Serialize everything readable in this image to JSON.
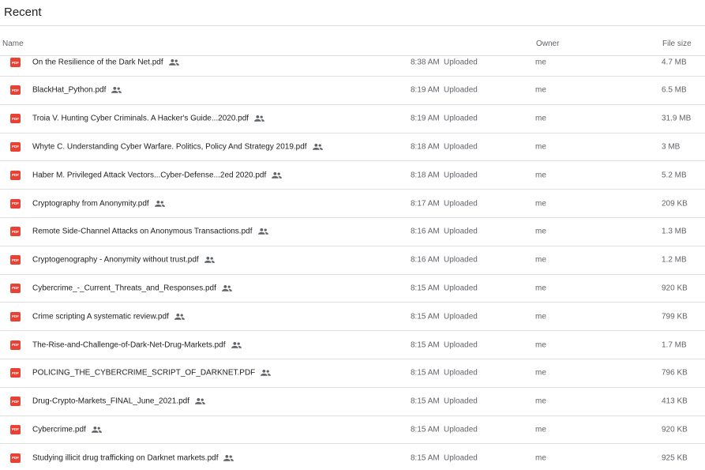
{
  "page": {
    "title": "Recent"
  },
  "columns": {
    "name": "Name",
    "owner": "Owner",
    "size": "File size"
  },
  "icons": {
    "file": "pdf-icon",
    "shared": "shared-people-icon",
    "pdf_color": "#e94235"
  },
  "files": [
    {
      "name": "On the Resilience of the Dark Net.pdf",
      "time": "8:38 AM",
      "action": "Uploaded",
      "owner": "me",
      "size": "4.7 MB"
    },
    {
      "name": "BlackHat_Python.pdf",
      "time": "8:19 AM",
      "action": "Uploaded",
      "owner": "me",
      "size": "6.5 MB"
    },
    {
      "name": "Troia V. Hunting Cyber Criminals. A Hacker's Guide...2020.pdf",
      "time": "8:19 AM",
      "action": "Uploaded",
      "owner": "me",
      "size": "31.9 MB"
    },
    {
      "name": "Whyte C. Understanding Cyber Warfare. Politics, Policy And Strategy 2019.pdf",
      "time": "8:18 AM",
      "action": "Uploaded",
      "owner": "me",
      "size": "3 MB"
    },
    {
      "name": "Haber M. Privileged Attack Vectors...Cyber-Defense...2ed 2020.pdf",
      "time": "8:18 AM",
      "action": "Uploaded",
      "owner": "me",
      "size": "5.2 MB"
    },
    {
      "name": "Cryptography from Anonymity.pdf",
      "time": "8:17 AM",
      "action": "Uploaded",
      "owner": "me",
      "size": "209 KB"
    },
    {
      "name": "Remote Side-Channel Attacks on Anonymous Transactions.pdf",
      "time": "8:16 AM",
      "action": "Uploaded",
      "owner": "me",
      "size": "1.3 MB"
    },
    {
      "name": "Cryptogenography - Anonymity without trust.pdf",
      "time": "8:16 AM",
      "action": "Uploaded",
      "owner": "me",
      "size": "1.2 MB"
    },
    {
      "name": "Cybercrime_-_Current_Threats_and_Responses.pdf",
      "time": "8:15 AM",
      "action": "Uploaded",
      "owner": "me",
      "size": "920 KB"
    },
    {
      "name": "Crime scripting A systematic review.pdf",
      "time": "8:15 AM",
      "action": "Uploaded",
      "owner": "me",
      "size": "799 KB"
    },
    {
      "name": "The-Rise-and-Challenge-of-Dark-Net-Drug-Markets.pdf",
      "time": "8:15 AM",
      "action": "Uploaded",
      "owner": "me",
      "size": "1.7 MB"
    },
    {
      "name": "POLICING_THE_CYBERCRIME_SCRIPT_OF_DARKNET.PDF",
      "time": "8:15 AM",
      "action": "Uploaded",
      "owner": "me",
      "size": "796 KB"
    },
    {
      "name": "Drug-Crypto-Markets_FINAL_June_2021.pdf",
      "time": "8:15 AM",
      "action": "Uploaded",
      "owner": "me",
      "size": "413 KB"
    },
    {
      "name": "Cybercrime.pdf",
      "time": "8:15 AM",
      "action": "Uploaded",
      "owner": "me",
      "size": "920 KB"
    },
    {
      "name": "Studying illicit drug trafficking on Darknet markets.pdf",
      "time": "8:15 AM",
      "action": "Uploaded",
      "owner": "me",
      "size": "925 KB"
    }
  ]
}
